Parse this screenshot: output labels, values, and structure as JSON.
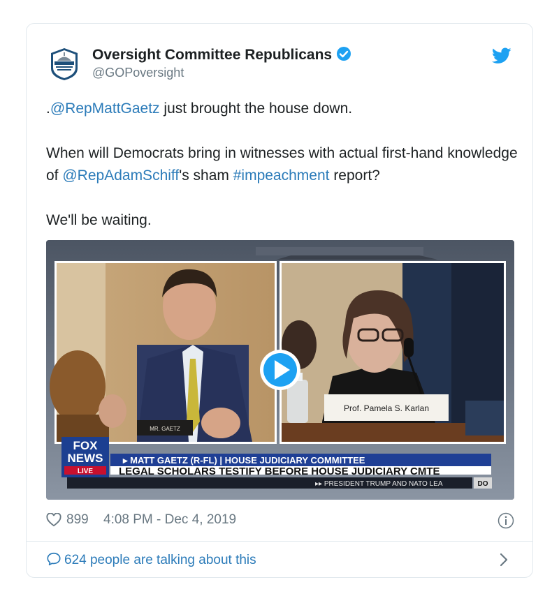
{
  "account": {
    "name": "Oversight Committee Republicans",
    "handle": "@GOPoversight"
  },
  "tweet": {
    "p1_mention": "@RepMattGaetz",
    "p1_prefix": ".",
    "p1_rest": " just brought the house down.",
    "p2_a": "When will Democrats bring in witnesses with actual first-hand knowledge of ",
    "p2_mention": "@RepAdamSchiff",
    "p2_b": "'s sham ",
    "p2_hashtag": "#impeachment",
    "p2_c": " report?",
    "p3": "We'll be waiting."
  },
  "video": {
    "left_nameplate": "MR. GAETZ",
    "right_nameplate": "Prof. Pamela S. Karlan",
    "network_line1": "FOX",
    "network_line2": "NEWS",
    "network_live": "LIVE",
    "chyron_title": "▸ MATT GAETZ (R-FL) | HOUSE JUDICIARY COMMITTEE",
    "chyron_sub": "LEGAL SCHOLARS TESTIFY BEFORE HOUSE JUDICIARY CMTE",
    "ticker": "▸▸  PRESIDENT TRUMP AND NATO LEA",
    "ticker_tag": "DO"
  },
  "footer": {
    "likes": "899",
    "timestamp": "4:08 PM - Dec 4, 2019",
    "talking": "624 people are talking about this"
  },
  "colors": {
    "link": "#2b7bb9",
    "twitter_blue": "#1da1f2",
    "fox_blue": "#1c3f91",
    "chyron_blue": "#1f3f95"
  },
  "icons": [
    "avatar-seal-icon",
    "verified-badge-icon",
    "twitter-bird-icon",
    "play-icon",
    "heart-icon",
    "info-icon",
    "comment-bubble-icon",
    "chevron-right-icon"
  ]
}
